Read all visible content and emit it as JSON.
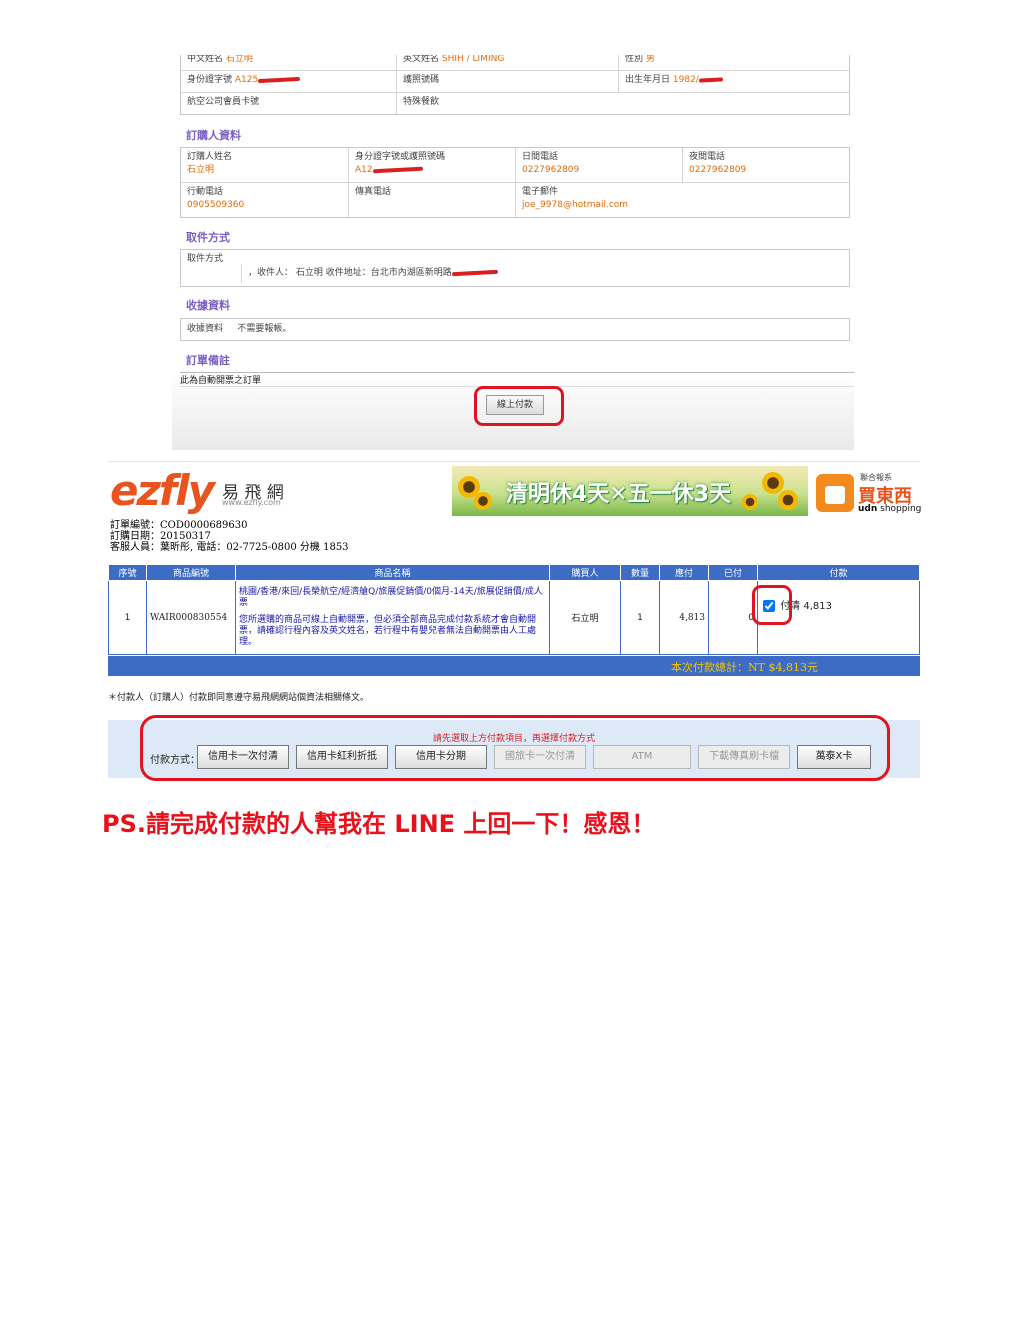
{
  "passenger": {
    "cn_name_label": "中文姓名",
    "cn_name_value": "石立明",
    "en_name_label": "英文姓名",
    "en_name_value": "SHIH / LIMING",
    "gender_label": "性別",
    "gender_value": "男",
    "id_label": "身份證字號",
    "id_value": "A125",
    "passport_label": "護照號碼",
    "dob_label": "出生年月日",
    "dob_value": "1982/",
    "member_label": "航空公司會員卡號",
    "special_label": "特殊餐飲"
  },
  "buyer": {
    "section_title": "訂購人資料",
    "name_label": "訂購人姓名",
    "name_value": "石立明",
    "id_label": "身分證字號或護照號碼",
    "id_value": "A12",
    "day_phone_label": "日間電話",
    "day_phone_value": "0227962809",
    "night_phone_label": "夜間電話",
    "night_phone_value": "0227962809",
    "mobile_label": "行動電話",
    "mobile_value": "0905509360",
    "fax_label": "傳真電話",
    "email_label": "電子郵件",
    "email_value": "joe_9978@hotmail.com"
  },
  "pickup": {
    "section_title": "取件方式",
    "method_label": "取件方式",
    "method_value": "，收件人： 石立明  收件地址：台北市內湖區新明路"
  },
  "receipt": {
    "section_title": "收據資料",
    "label": "收據資料",
    "value": "不需要報帳。"
  },
  "remark": {
    "section_title": "訂單備註",
    "value": "此為自動開票之訂單"
  },
  "online_pay_button": "線上付款",
  "brand": {
    "logo_text": "ezfly",
    "logo_cn": "易 飛 網",
    "logo_url": "www.ezfly.com",
    "banner_text": "清明休4天✕五一休3天",
    "udn_top": "聯合報系",
    "udn_cn": "買東西",
    "udn_bottom_bold": "udn",
    "udn_bottom": "shopping"
  },
  "order_info": {
    "order_no": "訂單編號：COD0000689630",
    "order_date": "訂購日期：20150317",
    "service": "客服人員：葉昕彤, 電話：02-7725-0800  分機 1853"
  },
  "table": {
    "headers": [
      "序號",
      "商品編號",
      "商品名稱",
      "購買人",
      "數量",
      "應付",
      "已付",
      "付款"
    ],
    "row": {
      "seq": "1",
      "product_code": "WAIR000830554",
      "product_name": "桃園/香港/來回/長榮航空/經濟艙Q/旅展促銷價/0個月-14天/旅展促銷價/成人票",
      "product_note": "您所選購的商品可線上自動開票，但必須全部商品完成付款系統才會自動開票，請確認行程內容及英文姓名，若行程中有嬰兒者無法自動開票由人工處理。",
      "buyer": "石立明",
      "qty": "1",
      "due": "4,813",
      "paid": "0",
      "pay_label": "付清",
      "pay_amount": "4,813",
      "pay_checked": true
    },
    "total_text": "本次付款總計：NT $4,813元"
  },
  "agreement": "＊付款人（訂購人）付款即同意遵守易飛網網站個資法相關條文。",
  "payment": {
    "hint": "請先選取上方付款項目，再選擇付款方式",
    "method_label": "付款方式：",
    "buttons": [
      "信用卡一次付清",
      "信用卡紅利折抵",
      "信用卡分期",
      "國旅卡一次付清",
      "ATM",
      "下載傳真刷卡檔",
      "萬泰X卡"
    ]
  },
  "ps_note": "PS.請完成付款的人幫我在 LINE 上回一下！感恩！",
  "colors": {
    "accent_blue": "#3d6cc4",
    "highlight_red": "#e0141e",
    "value_orange": "#e36c0a",
    "section_purple": "#7a5fc4"
  }
}
